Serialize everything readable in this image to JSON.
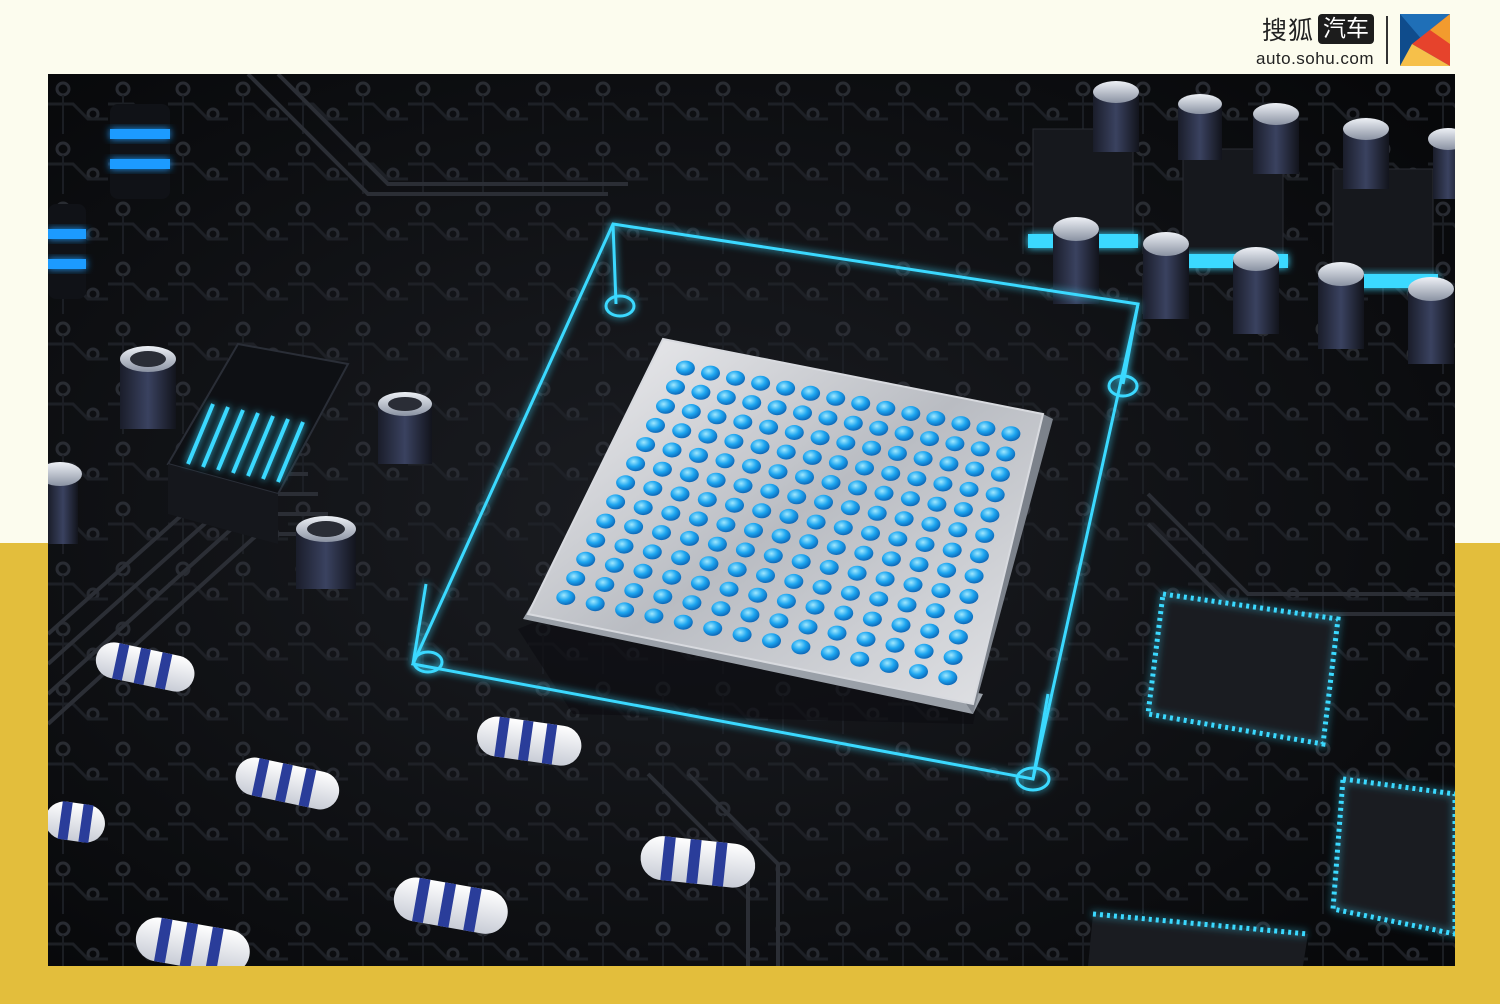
{
  "brand": {
    "name_part1": "搜狐",
    "name_part2": "汽车",
    "url": "auto.sohu.com",
    "logo_icon": "sohu-auto-logo-icon"
  },
  "photo": {
    "subject_icon": "circuit-board-chip-icon"
  },
  "colors": {
    "background_top": "#fcfcee",
    "band_yellow": "#e3be3c",
    "board_dark": "#0b0c0f",
    "glow_cyan": "#3ad9ff",
    "led_blue": "#1e9bff"
  }
}
